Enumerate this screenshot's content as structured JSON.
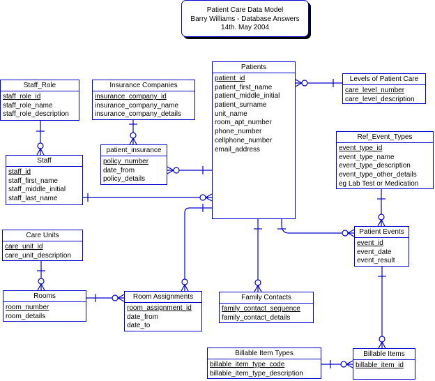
{
  "title": {
    "line1": "Patient Care Data Model",
    "line2": "Barry Williams - Database Answers",
    "line3": "14th. May 2004"
  },
  "colors": {
    "line": "#0000cc",
    "text": "#000000",
    "background": "#ffffff"
  },
  "entities": {
    "patients": {
      "name": "Patients",
      "attributes": [
        {
          "name": "patient_id",
          "pk": true
        },
        {
          "name": "patient_first_name",
          "pk": false
        },
        {
          "name": "patient_middle_initial",
          "pk": false
        },
        {
          "name": "patient_surname",
          "pk": false
        },
        {
          "name": "unit_name",
          "pk": false
        },
        {
          "name": "room_apt_number",
          "pk": false
        },
        {
          "name": "phone_number",
          "pk": false
        },
        {
          "name": "cellphone_number",
          "pk": false
        },
        {
          "name": "email_address",
          "pk": false
        }
      ]
    },
    "staff_role": {
      "name": "Staff_Role",
      "attributes": [
        {
          "name": "staff_role_id",
          "pk": true
        },
        {
          "name": "staff_role_name",
          "pk": false
        },
        {
          "name": "staff_role_description",
          "pk": false
        }
      ]
    },
    "staff": {
      "name": "Staff",
      "attributes": [
        {
          "name": "staff_id",
          "pk": true
        },
        {
          "name": "staff_first_name",
          "pk": false
        },
        {
          "name": "staff_middle_initial",
          "pk": false
        },
        {
          "name": "staff_last_name",
          "pk": false
        }
      ]
    },
    "insurance_companies": {
      "name": "Insurance Companies",
      "attributes": [
        {
          "name": "insurance_company_id",
          "pk": true
        },
        {
          "name": "insurance_company_name",
          "pk": false
        },
        {
          "name": "insurance_company_details",
          "pk": false
        }
      ]
    },
    "patient_insurance": {
      "name": "patient_insurance",
      "attributes": [
        {
          "name": "policy_number",
          "pk": true
        },
        {
          "name": "date_from",
          "pk": false
        },
        {
          "name": "policy_details",
          "pk": false
        }
      ]
    },
    "levels_of_patient_care": {
      "name": "Levels of Patient Care",
      "attributes": [
        {
          "name": "care_level_number",
          "pk": true
        },
        {
          "name": "care_level_description",
          "pk": false
        }
      ]
    },
    "ref_event_types": {
      "name": "Ref_Event_Types",
      "attributes": [
        {
          "name": "event_type_id",
          "pk": true
        },
        {
          "name": "event_type_name",
          "pk": false
        },
        {
          "name": "event_type_description",
          "pk": false
        },
        {
          "name": "event_type_other_details",
          "pk": false
        },
        {
          "name": "eg Lab Test or Medication",
          "pk": false
        }
      ]
    },
    "care_units": {
      "name": "Care Units",
      "attributes": [
        {
          "name": "care_unit_id",
          "pk": true
        },
        {
          "name": "care_unit_description",
          "pk": false
        }
      ]
    },
    "rooms": {
      "name": "Rooms",
      "attributes": [
        {
          "name": "room_number",
          "pk": true
        },
        {
          "name": "room_details",
          "pk": false
        }
      ]
    },
    "room_assignments": {
      "name": "Room Assignments",
      "attributes": [
        {
          "name": "room_assignment_id",
          "pk": true
        },
        {
          "name": "date_from",
          "pk": false
        },
        {
          "name": "date_to",
          "pk": false
        }
      ]
    },
    "family_contacts": {
      "name": "Family Contacts",
      "attributes": [
        {
          "name": "family_contact_sequence",
          "pk": true
        },
        {
          "name": "family_contact_details",
          "pk": false
        }
      ]
    },
    "patient_events": {
      "name": "Patient Events",
      "attributes": [
        {
          "name": "event_id",
          "pk": true
        },
        {
          "name": "event_date",
          "pk": false
        },
        {
          "name": "event_result",
          "pk": false
        }
      ]
    },
    "billable_item_types": {
      "name": "Billable Item Types",
      "attributes": [
        {
          "name": "billable_item_type_code",
          "pk": true
        },
        {
          "name": "billable_item_type_description",
          "pk": false
        }
      ]
    },
    "billable_items": {
      "name": "Billable Items",
      "attributes": [
        {
          "name": "billable_item_id",
          "pk": true
        }
      ]
    }
  },
  "relationships": [
    {
      "from": "staff_role",
      "to": "staff",
      "cardinality": "one-to-zero-or-many"
    },
    {
      "from": "insurance_companies",
      "to": "patient_insurance",
      "cardinality": "one-to-zero-or-many"
    },
    {
      "from": "patients",
      "to": "patient_insurance",
      "cardinality": "one-to-zero-or-many"
    },
    {
      "from": "levels_of_patient_care",
      "to": "patients",
      "cardinality": "one-to-zero-or-many"
    },
    {
      "from": "staff",
      "to": "patients",
      "cardinality": "one-to-zero-or-many"
    },
    {
      "from": "patients",
      "to": "room_assignments",
      "cardinality": "one-to-zero-or-many"
    },
    {
      "from": "care_units",
      "to": "rooms",
      "cardinality": "one-to-zero-or-many"
    },
    {
      "from": "rooms",
      "to": "room_assignments",
      "cardinality": "one-to-zero-or-many"
    },
    {
      "from": "patients",
      "to": "family_contacts",
      "cardinality": "one-to-zero-or-many"
    },
    {
      "from": "patients",
      "to": "patient_events",
      "cardinality": "one-to-zero-or-many"
    },
    {
      "from": "ref_event_types",
      "to": "patient_events",
      "cardinality": "one-to-zero-or-many"
    },
    {
      "from": "patient_events",
      "to": "billable_items",
      "cardinality": "one-to-zero-or-many"
    },
    {
      "from": "billable_item_types",
      "to": "billable_items",
      "cardinality": "one-to-zero-or-many"
    }
  ]
}
